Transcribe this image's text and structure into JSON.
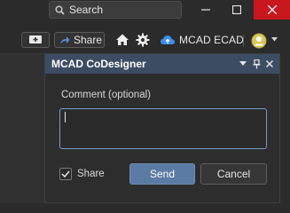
{
  "titlebar": {
    "search_label": "Search",
    "search_icon": "search-icon",
    "minimize_icon": "minimize-icon",
    "maximize_icon": "maximize-icon",
    "close_icon": "close-icon",
    "close_color": "#c8171e"
  },
  "toolbar": {
    "add_icon": "add-comment-icon",
    "share_label": "Share",
    "share_icon": "share-arrow-icon",
    "home_icon": "home-icon",
    "settings_icon": "gear-icon",
    "mcad_label": "MCAD ECAD",
    "mcad_icon": "cloud-icon",
    "user_icon": "user-avatar-icon"
  },
  "panel": {
    "title": "MCAD CoDesigner",
    "header_color": "#3c4c63",
    "comment_label": "Comment (optional)",
    "comment_value": "",
    "share_label": "Share",
    "share_checked": true,
    "send_label": "Send",
    "cancel_label": "Cancel",
    "accent": "#5b7ba4"
  }
}
